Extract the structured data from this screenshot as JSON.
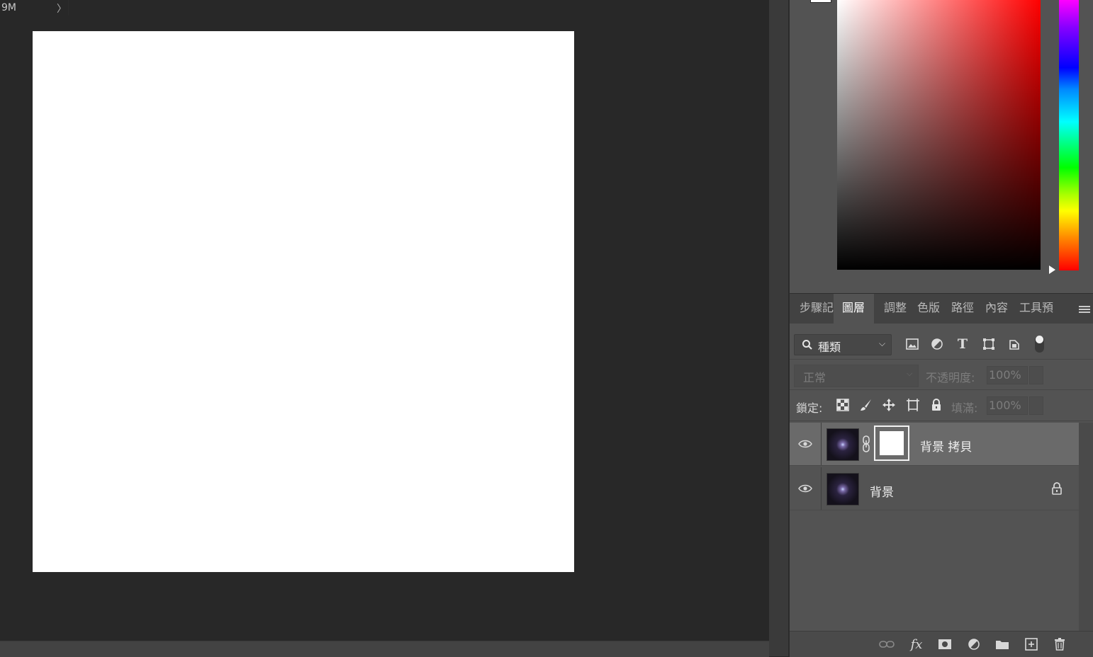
{
  "status": {
    "doc_size": "9M",
    "arrow": "〉"
  },
  "colors": {
    "foreground": "#ffffff",
    "hue_color": "#ff0000"
  },
  "tabs": [
    {
      "label": "步驟記",
      "active": false
    },
    {
      "label": "圖層",
      "active": true
    },
    {
      "label": "調整",
      "active": false
    },
    {
      "label": "色版",
      "active": false
    },
    {
      "label": "路徑",
      "active": false
    },
    {
      "label": "內容",
      "active": false
    },
    {
      "label": "工具預",
      "active": false
    }
  ],
  "filter": {
    "label": "種類",
    "icons": [
      "image-filter-icon",
      "adjustment-filter-icon",
      "type-filter-icon",
      "shape-filter-icon",
      "smart-object-filter-icon"
    ]
  },
  "blend": {
    "mode": "正常",
    "opacity_label": "不透明度:",
    "opacity_value": "100%"
  },
  "lock": {
    "label": "鎖定:",
    "fill_label": "填滿:",
    "fill_value": "100%"
  },
  "layers": [
    {
      "name": "背景 拷貝",
      "visible": true,
      "selected": true,
      "has_mask": true
    },
    {
      "name": "背景",
      "visible": true,
      "selected": false,
      "locked": true
    }
  ]
}
